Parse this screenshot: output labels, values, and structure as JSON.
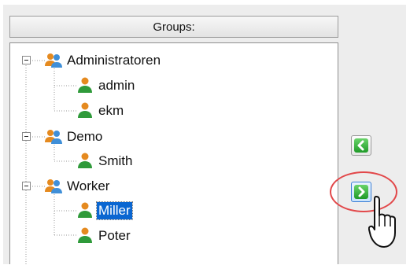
{
  "groups_panel": {
    "header": "Groups:"
  },
  "tree": {
    "nodes": [
      {
        "label": "Administratoren",
        "type": "group",
        "expanded": true
      },
      {
        "label": "admin",
        "type": "user"
      },
      {
        "label": "ekm",
        "type": "user"
      },
      {
        "label": "Demo",
        "type": "group",
        "expanded": true
      },
      {
        "label": "Smith",
        "type": "user"
      },
      {
        "label": "Worker",
        "type": "group",
        "expanded": true
      },
      {
        "label": "Miller",
        "type": "user",
        "selected": true
      },
      {
        "label": "Poter",
        "type": "user"
      }
    ]
  },
  "buttons": {
    "move_left": {
      "icon": "chevron-left-icon"
    },
    "move_right": {
      "icon": "chevron-right-icon",
      "highlighted": true
    }
  },
  "colors": {
    "selection": "#0a66d1",
    "arrow_green": "#2fae35",
    "highlight_circle": "#e2484a",
    "group_icon_orange": "#e58a1f",
    "user_icon_green": "#2f9a3a"
  }
}
